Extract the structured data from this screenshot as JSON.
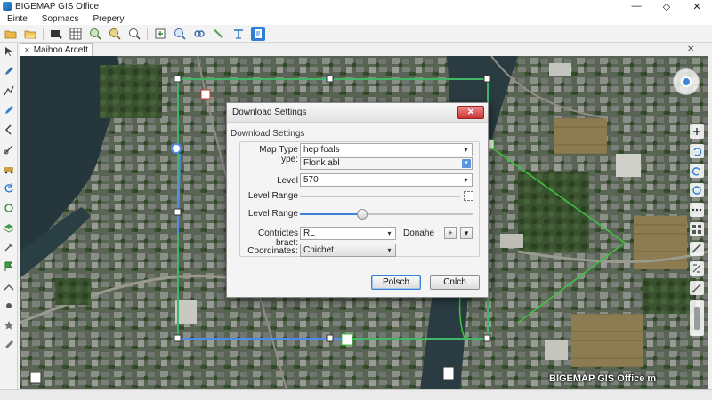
{
  "window": {
    "title": "BIGEMAP GIS Office",
    "controls": {
      "minimize": "—",
      "restore": "◇",
      "close": "✕"
    }
  },
  "menu": {
    "items": [
      {
        "label": "Einte"
      },
      {
        "label": "Sopmacs"
      },
      {
        "label": "Prepery"
      }
    ]
  },
  "toolbar": {
    "icons": [
      "folder-icon",
      "open-folder-icon",
      "pointer-icon",
      "grid-icon",
      "zoom-in-icon",
      "zoom-extent-icon",
      "search-icon",
      "add-layer-icon",
      "zoom-out-icon",
      "link-icon",
      "pin-icon",
      "measure-icon",
      "layer-panel-icon"
    ]
  },
  "tab": {
    "label": "Maihoo Arceft",
    "close": "✕"
  },
  "tab_close_right": "✕",
  "map": {
    "watermark": "BIGEMAP GIS Office m",
    "accent_green": "#3cc43c",
    "accent_blue": "#4f8ae6"
  },
  "dialog": {
    "title": "Download Settings",
    "close": "✕",
    "group": "Download Settings",
    "map_type": {
      "label": "Map Type Type:",
      "value": "hep foals",
      "option": "Flonk abl"
    },
    "level": {
      "label": "Level",
      "value": "570"
    },
    "level_range_1": {
      "label": "Level Range"
    },
    "level_range_2": {
      "label": "Level Range",
      "value": 0.36
    },
    "coordinates_base": {
      "label": "Contrictes bract:",
      "value": "RL",
      "suffix": "Donahe",
      "plus": "+",
      "dropdown": "▾"
    },
    "coordinates": {
      "label": "Coordinates:",
      "value": "Cnichet"
    },
    "buttons": {
      "ok": "Polsch",
      "cancel": "Cnlch"
    }
  }
}
